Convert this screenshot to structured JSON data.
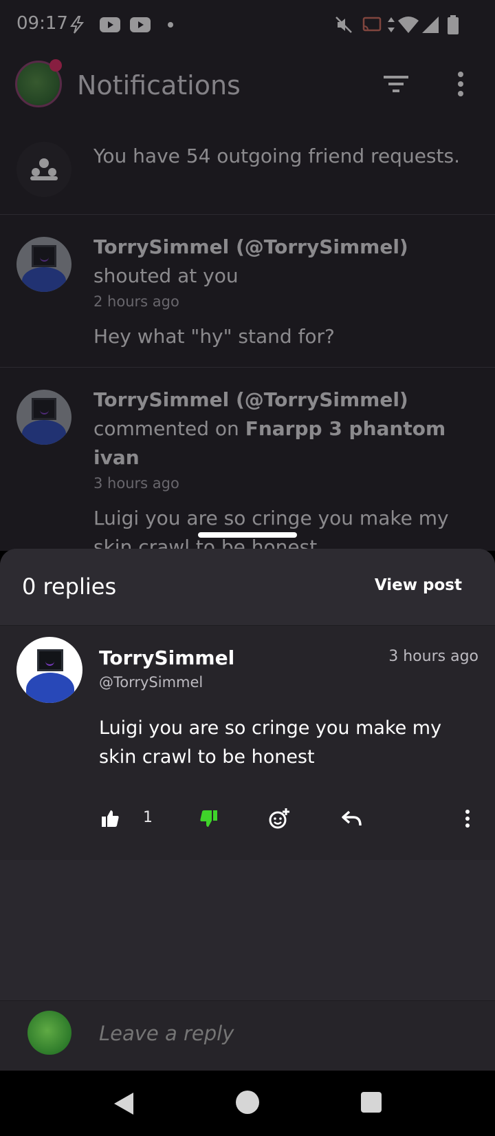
{
  "status_bar": {
    "time": "09:17",
    "icons": [
      "bolt-icon",
      "youtube-icon",
      "youtube-icon",
      "dot-icon",
      "mute-icon",
      "cast-icon",
      "data-arrows-icon",
      "wifi-icon",
      "signal-icon",
      "battery-icon"
    ]
  },
  "app_bar": {
    "title": "Notifications",
    "avatar": "user-avatar",
    "actions": [
      "filter-icon",
      "more-vertical-icon"
    ]
  },
  "notifications": [
    {
      "icon": "friends-icon",
      "text": "You have 54 outgoing friend requests."
    },
    {
      "user": "TorrySimmel (@TorrySimmel)",
      "action": "shouted at you",
      "time": "2 hours ago",
      "body": "Hey what \"hy\" stand for?"
    },
    {
      "user": "TorrySimmel (@TorrySimmel)",
      "action": "commented on",
      "target": "Fnarpp 3 phantom ivan",
      "time": "3 hours ago",
      "body": "Luigi you are so cringe you make my skin crawl to be honest"
    }
  ],
  "sheet": {
    "replies_label": "0 replies",
    "view_post_label": "View post",
    "comment": {
      "name": "TorrySimmel",
      "handle": "@TorrySimmel",
      "time": "3 hours ago",
      "body": "Luigi you are so cringe you make my skin crawl to be honest",
      "like_count": "1",
      "actions": [
        "thumbs-up-icon",
        "thumbs-down-icon",
        "add-emoji-icon",
        "reply-icon",
        "more-vertical-icon"
      ],
      "colors": {
        "dislike_active": "#3fd42a"
      }
    },
    "reply_placeholder": "Leave a reply"
  },
  "nav_bar": {
    "buttons": [
      "back-icon",
      "home-icon",
      "recents-icon"
    ]
  }
}
